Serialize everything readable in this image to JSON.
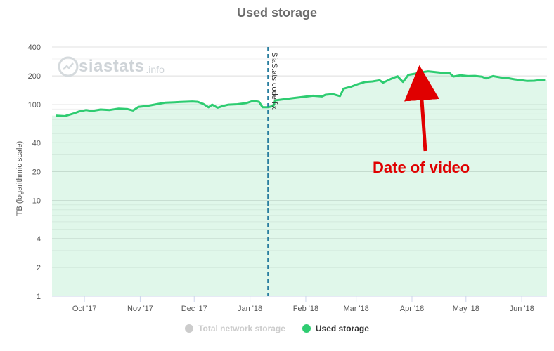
{
  "chart_data": {
    "type": "area",
    "title": "Used storage",
    "ylabel": "TB (logarithmic scale)",
    "yscale": "log",
    "ylim": [
      1,
      400
    ],
    "yticks": [
      1,
      2,
      4,
      10,
      20,
      40,
      100,
      200,
      400
    ],
    "xlim": [
      "2017-09-13",
      "2018-06-15"
    ],
    "xticks": [
      {
        "date": "2017-10-01",
        "label": "Oct '17"
      },
      {
        "date": "2017-11-01",
        "label": "Nov '17"
      },
      {
        "date": "2017-12-01",
        "label": "Dec '17"
      },
      {
        "date": "2018-01-01",
        "label": "Jan '18"
      },
      {
        "date": "2018-02-01",
        "label": "Feb '18"
      },
      {
        "date": "2018-03-01",
        "label": "Mar '18"
      },
      {
        "date": "2018-04-01",
        "label": "Apr '18"
      },
      {
        "date": "2018-05-01",
        "label": "May '18"
      },
      {
        "date": "2018-06-01",
        "label": "Jun '18"
      }
    ],
    "grid": true,
    "legend_position": "bottom-center",
    "series": [
      {
        "name": "Used storage",
        "color": "#2ecc71",
        "points": [
          [
            "2017-09-15",
            77
          ],
          [
            "2017-09-20",
            76
          ],
          [
            "2017-09-25",
            81
          ],
          [
            "2017-09-28",
            85
          ],
          [
            "2017-10-02",
            88
          ],
          [
            "2017-10-05",
            86
          ],
          [
            "2017-10-10",
            89
          ],
          [
            "2017-10-15",
            88
          ],
          [
            "2017-10-20",
            91
          ],
          [
            "2017-10-25",
            90
          ],
          [
            "2017-10-28",
            87
          ],
          [
            "2017-10-31",
            95
          ],
          [
            "2017-11-05",
            97
          ],
          [
            "2017-11-10",
            101
          ],
          [
            "2017-11-15",
            105
          ],
          [
            "2017-11-20",
            106
          ],
          [
            "2017-11-25",
            107
          ],
          [
            "2017-11-30",
            108
          ],
          [
            "2017-12-03",
            107
          ],
          [
            "2017-12-06",
            102
          ],
          [
            "2017-12-09",
            94
          ],
          [
            "2017-12-11",
            100
          ],
          [
            "2017-12-14",
            93
          ],
          [
            "2017-12-17",
            97
          ],
          [
            "2017-12-20",
            100
          ],
          [
            "2017-12-25",
            101
          ],
          [
            "2017-12-30",
            104
          ],
          [
            "2018-01-03",
            110
          ],
          [
            "2018-01-06",
            107
          ],
          [
            "2018-01-08",
            94
          ],
          [
            "2018-01-11",
            94
          ],
          [
            "2018-01-14",
            97
          ],
          [
            "2018-01-15",
            111
          ],
          [
            "2018-01-20",
            114
          ],
          [
            "2018-01-25",
            117
          ],
          [
            "2018-01-30",
            120
          ],
          [
            "2018-02-05",
            124
          ],
          [
            "2018-02-10",
            122
          ],
          [
            "2018-02-12",
            127
          ],
          [
            "2018-02-16",
            129
          ],
          [
            "2018-02-20",
            123
          ],
          [
            "2018-02-22",
            147
          ],
          [
            "2018-02-26",
            154
          ],
          [
            "2018-03-02",
            164
          ],
          [
            "2018-03-06",
            173
          ],
          [
            "2018-03-10",
            175
          ],
          [
            "2018-03-14",
            180
          ],
          [
            "2018-03-16",
            170
          ],
          [
            "2018-03-20",
            185
          ],
          [
            "2018-03-24",
            198
          ],
          [
            "2018-03-27",
            173
          ],
          [
            "2018-03-30",
            205
          ],
          [
            "2018-04-03",
            211
          ],
          [
            "2018-04-07",
            219
          ],
          [
            "2018-04-10",
            223
          ],
          [
            "2018-04-15",
            218
          ],
          [
            "2018-04-19",
            214
          ],
          [
            "2018-04-22",
            213
          ],
          [
            "2018-04-24",
            197
          ],
          [
            "2018-04-28",
            203
          ],
          [
            "2018-05-02",
            199
          ],
          [
            "2018-05-06",
            200
          ],
          [
            "2018-05-10",
            196
          ],
          [
            "2018-05-12",
            188
          ],
          [
            "2018-05-16",
            199
          ],
          [
            "2018-05-20",
            193
          ],
          [
            "2018-05-24",
            190
          ],
          [
            "2018-05-28",
            184
          ],
          [
            "2018-06-01",
            180
          ],
          [
            "2018-06-04",
            177
          ],
          [
            "2018-06-08",
            178
          ],
          [
            "2018-06-12",
            182
          ],
          [
            "2018-06-14",
            181
          ]
        ]
      }
    ],
    "plot_line": {
      "date": "2018-01-11",
      "label": "SiaStats code fix",
      "color": "#2a7ea0",
      "style": "dashed"
    },
    "annotation": {
      "text": "Date of video",
      "color": "#e00000",
      "arrow_to_date": "2018-04-05",
      "arrow_to_value": 215
    }
  },
  "legend": {
    "items": [
      {
        "label": "Total network storage",
        "color": "#cccccc",
        "visible": false
      },
      {
        "label": "Used storage",
        "color": "#2ecc71",
        "visible": true
      }
    ]
  },
  "watermark": {
    "main": "siastats",
    "sub": ".info"
  }
}
